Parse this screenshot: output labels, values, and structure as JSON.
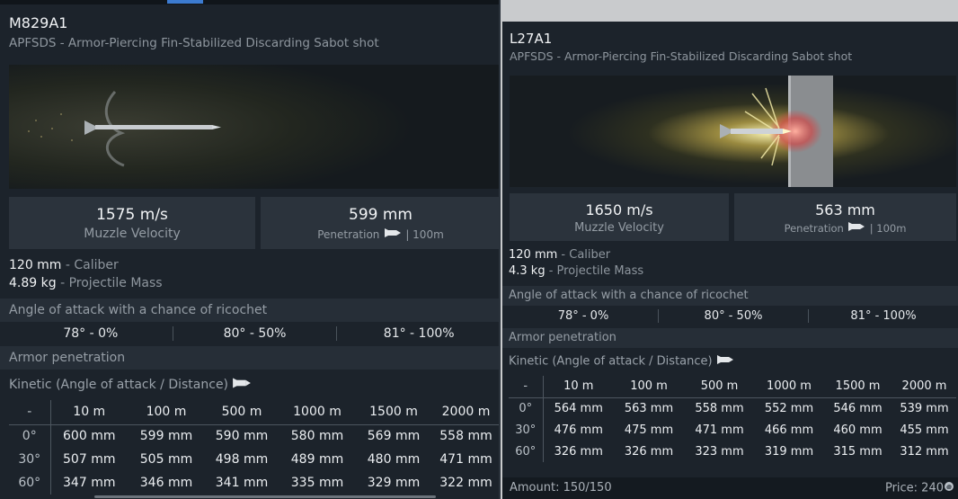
{
  "left": {
    "title": "M829A1",
    "subtitle": "APFSDS - Armor-Piercing Fin-Stabilized Discarding Sabot shot",
    "velocity": {
      "value": "1575 m/s",
      "label": "Muzzle Velocity"
    },
    "penetration": {
      "value": "599 mm",
      "label": "Penetration",
      "distance": "| 100m"
    },
    "caliber": {
      "value": "120 mm",
      "label": "- Caliber"
    },
    "mass": {
      "value": "4.89 kg",
      "label": "- Projectile Mass"
    },
    "ricochet_header": "Angle of attack with a chance of ricochet",
    "ricochet": [
      "78° - 0%",
      "80° - 50%",
      "81° - 100%"
    ],
    "armor_header": "Armor penetration",
    "kinetic_label": "Kinetic (Angle of attack / Distance)",
    "table": {
      "header": [
        "-",
        "10 m",
        "100 m",
        "500 m",
        "1000 m",
        "1500 m",
        "2000 m"
      ],
      "rows": [
        [
          "0°",
          "600 mm",
          "599 mm",
          "590 mm",
          "580 mm",
          "569 mm",
          "558 mm"
        ],
        [
          "30°",
          "507 mm",
          "505 mm",
          "498 mm",
          "489 mm",
          "480 mm",
          "471 mm"
        ],
        [
          "60°",
          "347 mm",
          "346 mm",
          "341 mm",
          "335 mm",
          "329 mm",
          "322 mm"
        ]
      ]
    }
  },
  "right": {
    "title": "L27A1",
    "subtitle": "APFSDS - Armor-Piercing Fin-Stabilized Discarding Sabot shot",
    "velocity": {
      "value": "1650 m/s",
      "label": "Muzzle Velocity"
    },
    "penetration": {
      "value": "563 mm",
      "label": "Penetration",
      "distance": "| 100m"
    },
    "caliber": {
      "value": "120 mm",
      "label": "- Caliber"
    },
    "mass": {
      "value": "4.3 kg",
      "label": "- Projectile Mass"
    },
    "ricochet_header": "Angle of attack with a chance of ricochet",
    "ricochet": [
      "78° - 0%",
      "80° - 50%",
      "81° - 100%"
    ],
    "armor_header": "Armor penetration",
    "kinetic_label": "Kinetic (Angle of attack / Distance)",
    "table": {
      "header": [
        "-",
        "10 m",
        "100 m",
        "500 m",
        "1000 m",
        "1500 m",
        "2000 m"
      ],
      "rows": [
        [
          "0°",
          "564 mm",
          "563 mm",
          "558 mm",
          "552 mm",
          "546 mm",
          "539 mm"
        ],
        [
          "30°",
          "476 mm",
          "475 mm",
          "471 mm",
          "466 mm",
          "460 mm",
          "455 mm"
        ],
        [
          "60°",
          "326 mm",
          "326 mm",
          "323 mm",
          "319 mm",
          "315 mm",
          "312 mm"
        ]
      ]
    },
    "footer": {
      "amount": "Amount: 150/150",
      "price": "Price: 240"
    }
  },
  "icons": {
    "shell": "shell-icon",
    "currency": "silver-lion-icon"
  },
  "colors": {
    "panel": "#1c232b",
    "section": "#262e37",
    "stat_box": "#2b333c",
    "muted_text": "#8e969e"
  }
}
